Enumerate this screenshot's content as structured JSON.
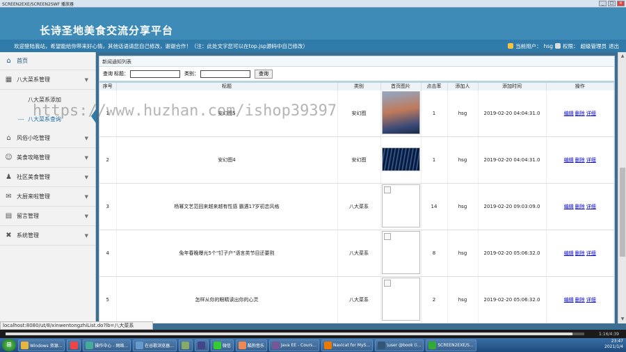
{
  "window": {
    "title": "SCREEN2EXE/SCREEN2SWF 播放器",
    "min": "_",
    "max": "□",
    "close": "×"
  },
  "header": {
    "site_title": "长诗圣地美食交流分享平台"
  },
  "marquee": {
    "message": "欢迎登陆我站，希望能给你带来好心情，其他话语请您自己修改，谢谢合作！（注：此处文字您可以在top.jsp源码中自己修改）",
    "user_label": "当前用户：",
    "user": "hsg",
    "role_label": "权限：",
    "role": "超级管理员",
    "logout": "退出"
  },
  "sidebar": {
    "home": "首页",
    "groups": [
      {
        "label": "八大菜系管理",
        "icon": "grid-icon",
        "open": true,
        "items": [
          {
            "label": "八大菜系添加"
          },
          {
            "label": "八大菜系查询"
          }
        ]
      },
      {
        "label": "风俗小吃管理",
        "icon": "house-icon"
      },
      {
        "label": "美食攻略管理",
        "icon": "users-icon"
      },
      {
        "label": "社区美食管理",
        "icon": "person-icon"
      },
      {
        "label": "大厨来啦管理",
        "icon": "chat-icon"
      },
      {
        "label": "留言管理",
        "icon": "clipboard-icon"
      },
      {
        "label": "系统管理",
        "icon": "tools-icon"
      }
    ]
  },
  "main": {
    "breadcrumb": "新闻通知列表",
    "search": {
      "label": "查询",
      "title_label": "标题：",
      "cat_label": "类别：",
      "button": "查询"
    },
    "columns": [
      "序号",
      "标题",
      "类别",
      "首页图片",
      "点击率",
      "添加人",
      "添加时间",
      "操作"
    ],
    "actions": [
      "编辑",
      "删除",
      "详细"
    ],
    "rows": [
      {
        "no": "1",
        "title": "安幻图5",
        "cat": "安幻图",
        "img": "i1",
        "hits": "1",
        "user": "hsg",
        "time": "2019-02-20 04:04:31.0"
      },
      {
        "no": "2",
        "title": "安幻图4",
        "cat": "安幻图",
        "img": "i2",
        "hits": "1",
        "user": "hsg",
        "time": "2019-02-20 04:04:31.0"
      },
      {
        "no": "3",
        "title": "杨幂文艺范回来越来越有性感 霸遇17岁初恋风格",
        "cat": "八大菜系",
        "img": "broken",
        "hits": "14",
        "user": "hsg",
        "time": "2019-02-20 09:03:09.0"
      },
      {
        "no": "4",
        "title": "兔年春晚曝光5个\"钉子户\"语言类节目还要割",
        "cat": "八大菜系",
        "img": "broken",
        "hits": "8",
        "user": "hsg",
        "time": "2019-02-20 05:06:32.0"
      },
      {
        "no": "5",
        "title": "怎样从你的眼睛读出你的心灵",
        "cat": "八大菜系",
        "img": "broken",
        "hits": "2",
        "user": "hsg",
        "time": "2019-02-20 05:06:32.0"
      }
    ]
  },
  "watermark": "https://www.huzhan.com/ishop39397",
  "status": "localhost:8080/ut/8/xinwentongzhiList.do?lb=八大菜系",
  "player": {
    "time": "1:16/4:39"
  },
  "taskbar": {
    "items": [
      {
        "label": "Windows 资源...",
        "color": "#e8b640"
      },
      {
        "label": "",
        "color": "#e44"
      },
      {
        "label": "操作中心 - 网络...",
        "color": "#4a9"
      },
      {
        "label": "在谷歌浏览器...",
        "color": "#69c"
      },
      {
        "label": "",
        "color": "#8a6"
      },
      {
        "label": "",
        "color": "#448"
      },
      {
        "label": "微信",
        "color": "#3c3"
      },
      {
        "label": "酷狗音乐",
        "color": "#e85"
      },
      {
        "label": "Java EE - Cours...",
        "color": "#759"
      },
      {
        "label": "Navicat for MyS...",
        "color": "#e70"
      },
      {
        "label": "\\user @book (i...",
        "color": "#357"
      },
      {
        "label": "SCREEN2EXE/S...",
        "color": "#3a3"
      }
    ],
    "clock": "23:47",
    "date": "2021/1/4"
  }
}
